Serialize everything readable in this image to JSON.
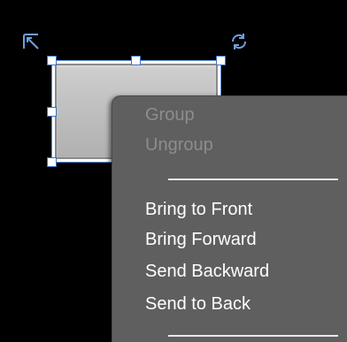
{
  "context_menu": {
    "items": [
      {
        "label": "Group",
        "enabled": false
      },
      {
        "label": "Ungroup",
        "enabled": false
      },
      {
        "label": "Bring to Front",
        "enabled": true
      },
      {
        "label": "Bring Forward",
        "enabled": true
      },
      {
        "label": "Send Backward",
        "enabled": true
      },
      {
        "label": "Send to Back",
        "enabled": true
      }
    ]
  },
  "icons": {
    "resize": "resize-diagonal-icon",
    "rotate": "rotate-icon"
  },
  "colors": {
    "background": "#000000",
    "menu_background": "#5f5f5f",
    "menu_text": "#ffffff",
    "menu_text_disabled": "#8d8d8d",
    "selection_border": "#3a6fc4",
    "shape_fill": "#c4c4c4"
  }
}
